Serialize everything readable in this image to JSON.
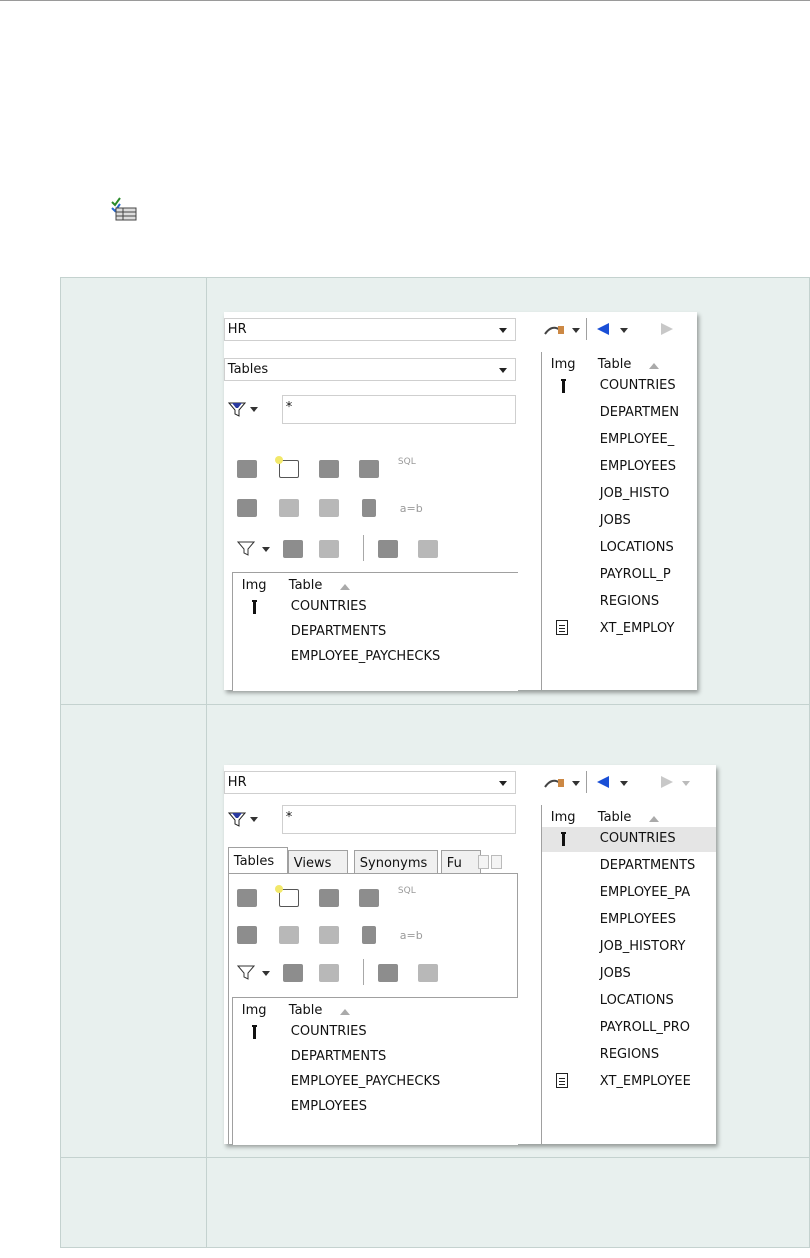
{
  "header_icon": "grid-checklist-icon",
  "panel_old": {
    "schema": "HR",
    "object_type": "Tables",
    "filter_text": "*",
    "grid_headers": {
      "img": "Img",
      "table": "Table"
    },
    "grid_rows": [
      "COUNTRIES",
      "DEPARTMENTS",
      "EMPLOYEE_PAYCHECKS"
    ],
    "right_headers": {
      "img": "Img",
      "table": "Table"
    },
    "right_rows": [
      "COUNTRIES",
      "DEPARTMEN",
      "EMPLOYEE_",
      "EMPLOYEES",
      "JOB_HISTO",
      "JOBS",
      "LOCATIONS",
      "PAYROLL_P",
      "REGIONS",
      "XT_EMPLOY"
    ],
    "toolbar_text": {
      "sql": "SQL",
      "a_equals_b": "a=b"
    }
  },
  "panel_new": {
    "schema": "HR",
    "filter_text": "*",
    "tabs": [
      "Tables",
      "Views",
      "Synonyms",
      "Fu"
    ],
    "grid_headers": {
      "img": "Img",
      "table": "Table"
    },
    "grid_rows": [
      "COUNTRIES",
      "DEPARTMENTS",
      "EMPLOYEE_PAYCHECKS",
      "EMPLOYEES"
    ],
    "right_headers": {
      "img": "Img",
      "table": "Table"
    },
    "right_rows": [
      "COUNTRIES",
      "DEPARTMENTS",
      "EMPLOYEE_PA",
      "EMPLOYEES",
      "JOB_HISTORY",
      "JOBS",
      "LOCATIONS",
      "PAYROLL_PRO",
      "REGIONS",
      "XT_EMPLOYEE"
    ],
    "toolbar_text": {
      "sql": "SQL",
      "a_equals_b": "a=b"
    }
  },
  "colors": {
    "cell_bg": "#e8f0ee",
    "cell_border": "#c4d2cf",
    "selected_row": "#e5e5e5",
    "nav_blue": "#1a4fd6"
  }
}
